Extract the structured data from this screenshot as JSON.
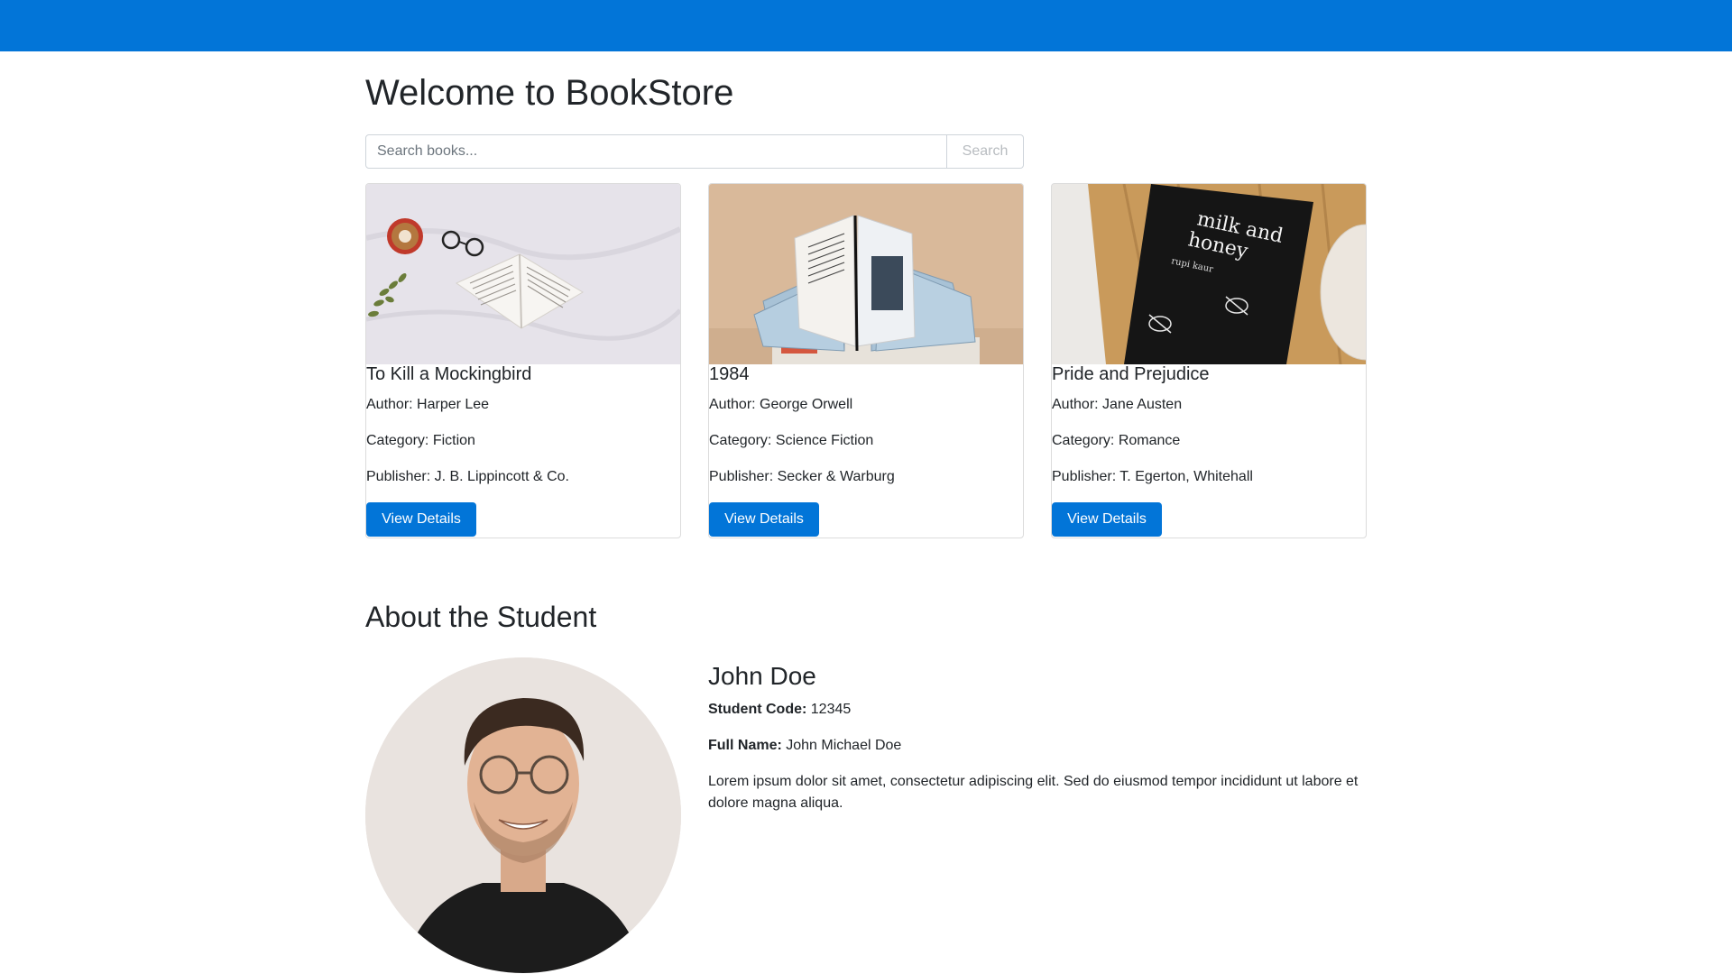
{
  "header": {
    "title": "Welcome to BookStore"
  },
  "search": {
    "placeholder": "Search books...",
    "value": "",
    "button_label": "Search"
  },
  "books": [
    {
      "title": "To Kill a Mockingbird",
      "author": "Author: Harper Lee",
      "category": "Category: Fiction",
      "publisher": "Publisher: J. B. Lippincott & Co.",
      "button_label": "View Details"
    },
    {
      "title": "1984",
      "author": "Author: George Orwell",
      "category": "Category: Science Fiction",
      "publisher": "Publisher: Secker & Warburg",
      "button_label": "View Details"
    },
    {
      "title": "Pride and Prejudice",
      "author": "Author: Jane Austen",
      "category": "Category: Romance",
      "publisher": "Publisher: T. Egerton, Whitehall",
      "button_label": "View Details"
    }
  ],
  "about": {
    "heading": "About the Student",
    "name": "John Doe",
    "student_code_label": "Student Code:",
    "student_code": "12345",
    "full_name_label": "Full Name:",
    "full_name": "John Michael Doe",
    "bio": "Lorem ipsum dolor sit amet, consectetur adipiscing elit. Sed do eiusmod tempor incididunt ut labore et dolore magna aliqua."
  },
  "book_cover_art": {
    "text_line_1": "milk and",
    "text_line_2": "honey",
    "author_line": "rupi kaur"
  },
  "colors": {
    "primary": "#0275d8",
    "text": "#212529",
    "border": "#dcdcdc"
  }
}
